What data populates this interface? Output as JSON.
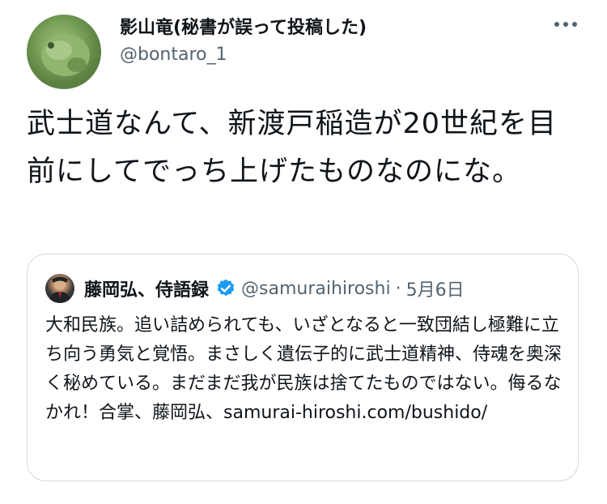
{
  "tweet": {
    "author_name": "影山竜(秘書が誤って投稿した)",
    "author_handle": "@bontaro_1",
    "more_icon": "more-horizontal-icon",
    "text": "武士道なんて、新渡戸稲造が20世紀を目前にしてでっち上げたものなのにな。"
  },
  "quote": {
    "author_name": "藤岡弘、侍語録",
    "verified_icon": "verified-badge-icon",
    "handle": "@samuraihiroshi",
    "separator": "·",
    "date": "5月6日",
    "text": "大和民族。追い詰められても、いざとなると一致団結し極難に立ち向う勇気と覚悟。まさしく遺伝子的に武士道精神、侍魂を奥深く秘めている。まだまだ我が民族は捨てたものではない。侮るなかれ！合掌、藤岡弘、samurai-hiroshi.com/bushido/"
  },
  "colors": {
    "text_primary": "#0f1419",
    "text_secondary": "#536471",
    "border": "#cfd9de",
    "verified": "#1d9bf0"
  }
}
